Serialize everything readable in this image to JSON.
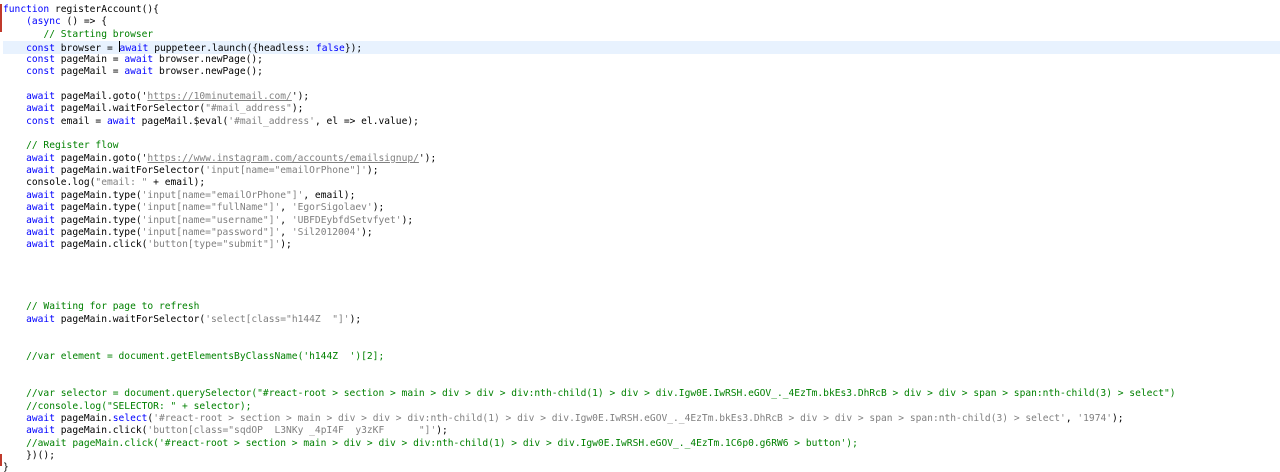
{
  "colors": {
    "background": "#ffffff",
    "keyword": "#0000ff",
    "comment": "#008000",
    "string": "#808080",
    "text": "#000000",
    "active_line": "#e8f2fe",
    "gutter_marker": "#c0392b"
  },
  "active_line_index": 3,
  "lines": [
    [
      {
        "t": "kw",
        "v": "function"
      },
      {
        "t": "txt",
        "v": " registerAccount(){"
      }
    ],
    [
      {
        "t": "txt",
        "v": "    "
      },
      {
        "t": "kw",
        "v": "(async"
      },
      {
        "t": "txt",
        "v": " () => {"
      }
    ],
    [
      {
        "t": "txt",
        "v": "       "
      },
      {
        "t": "cm",
        "v": "// Starting browser"
      }
    ],
    [
      {
        "t": "txt",
        "v": "    "
      },
      {
        "t": "kw",
        "v": "const"
      },
      {
        "t": "txt",
        "v": " browser = "
      },
      {
        "t": "kw",
        "v": "await"
      },
      {
        "t": "txt",
        "v": " puppeteer.launch({headless: "
      },
      {
        "t": "kw",
        "v": "false"
      },
      {
        "t": "txt",
        "v": "});"
      }
    ],
    [
      {
        "t": "txt",
        "v": "    "
      },
      {
        "t": "kw",
        "v": "const"
      },
      {
        "t": "txt",
        "v": " pageMain = "
      },
      {
        "t": "kw",
        "v": "await"
      },
      {
        "t": "txt",
        "v": " browser.newPage();"
      }
    ],
    [
      {
        "t": "txt",
        "v": "    "
      },
      {
        "t": "kw",
        "v": "const"
      },
      {
        "t": "txt",
        "v": " pageMail = "
      },
      {
        "t": "kw",
        "v": "await"
      },
      {
        "t": "txt",
        "v": " browser.newPage();"
      }
    ],
    [
      {
        "t": "txt",
        "v": ""
      }
    ],
    [
      {
        "t": "txt",
        "v": "    "
      },
      {
        "t": "kw",
        "v": "await"
      },
      {
        "t": "txt",
        "v": " pageMail.goto('"
      },
      {
        "t": "url",
        "v": "https://10minutemail.com/"
      },
      {
        "t": "txt",
        "v": "');"
      }
    ],
    [
      {
        "t": "txt",
        "v": "    "
      },
      {
        "t": "kw",
        "v": "await"
      },
      {
        "t": "txt",
        "v": " pageMail.waitForSelector("
      },
      {
        "t": "str",
        "v": "\"#mail_address\""
      },
      {
        "t": "txt",
        "v": ");"
      }
    ],
    [
      {
        "t": "txt",
        "v": "    "
      },
      {
        "t": "kw",
        "v": "const"
      },
      {
        "t": "txt",
        "v": " email = "
      },
      {
        "t": "kw",
        "v": "await"
      },
      {
        "t": "txt",
        "v": " pageMail.$eval("
      },
      {
        "t": "str",
        "v": "'#mail_address'"
      },
      {
        "t": "txt",
        "v": ", el => el.value);"
      }
    ],
    [
      {
        "t": "txt",
        "v": ""
      }
    ],
    [
      {
        "t": "txt",
        "v": "    "
      },
      {
        "t": "cm",
        "v": "// Register flow"
      }
    ],
    [
      {
        "t": "txt",
        "v": "    "
      },
      {
        "t": "kw",
        "v": "await"
      },
      {
        "t": "txt",
        "v": " pageMain.goto('"
      },
      {
        "t": "url",
        "v": "https://www.instagram.com/accounts/emailsignup/"
      },
      {
        "t": "txt",
        "v": "');"
      }
    ],
    [
      {
        "t": "txt",
        "v": "    "
      },
      {
        "t": "kw",
        "v": "await"
      },
      {
        "t": "txt",
        "v": " pageMain.waitForSelector("
      },
      {
        "t": "str",
        "v": "'input[name=\"emailOrPhone\"]'"
      },
      {
        "t": "txt",
        "v": ");"
      }
    ],
    [
      {
        "t": "txt",
        "v": "    console.log("
      },
      {
        "t": "str",
        "v": "\"email: \""
      },
      {
        "t": "txt",
        "v": " + email);"
      }
    ],
    [
      {
        "t": "txt",
        "v": "    "
      },
      {
        "t": "kw",
        "v": "await"
      },
      {
        "t": "txt",
        "v": " pageMain.type("
      },
      {
        "t": "str",
        "v": "'input[name=\"emailOrPhone\"]'"
      },
      {
        "t": "txt",
        "v": ", email);"
      }
    ],
    [
      {
        "t": "txt",
        "v": "    "
      },
      {
        "t": "kw",
        "v": "await"
      },
      {
        "t": "txt",
        "v": " pageMain.type("
      },
      {
        "t": "str",
        "v": "'input[name=\"fullName\"]'"
      },
      {
        "t": "txt",
        "v": ", "
      },
      {
        "t": "str",
        "v": "'EgorSigolaev'"
      },
      {
        "t": "txt",
        "v": ");"
      }
    ],
    [
      {
        "t": "txt",
        "v": "    "
      },
      {
        "t": "kw",
        "v": "await"
      },
      {
        "t": "txt",
        "v": " pageMain.type("
      },
      {
        "t": "str",
        "v": "'input[name=\"username\"]'"
      },
      {
        "t": "txt",
        "v": ", "
      },
      {
        "t": "str",
        "v": "'UBFDEybfdSetvfyet'"
      },
      {
        "t": "txt",
        "v": ");"
      }
    ],
    [
      {
        "t": "txt",
        "v": "    "
      },
      {
        "t": "kw",
        "v": "await"
      },
      {
        "t": "txt",
        "v": " pageMain.type("
      },
      {
        "t": "str",
        "v": "'input[name=\"password\"]'"
      },
      {
        "t": "txt",
        "v": ", "
      },
      {
        "t": "str",
        "v": "'Sil2012004'"
      },
      {
        "t": "txt",
        "v": ");"
      }
    ],
    [
      {
        "t": "txt",
        "v": "    "
      },
      {
        "t": "kw",
        "v": "await"
      },
      {
        "t": "txt",
        "v": " pageMain.click("
      },
      {
        "t": "str",
        "v": "'button[type=\"submit\"]'"
      },
      {
        "t": "txt",
        "v": ");"
      }
    ],
    [
      {
        "t": "txt",
        "v": ""
      }
    ],
    [
      {
        "t": "txt",
        "v": ""
      }
    ],
    [
      {
        "t": "txt",
        "v": ""
      }
    ],
    [
      {
        "t": "txt",
        "v": ""
      }
    ],
    [
      {
        "t": "txt",
        "v": "    "
      },
      {
        "t": "cm",
        "v": "// Waiting for page to refresh"
      }
    ],
    [
      {
        "t": "txt",
        "v": "    "
      },
      {
        "t": "kw",
        "v": "await"
      },
      {
        "t": "txt",
        "v": " pageMain.waitForSelector("
      },
      {
        "t": "str",
        "v": "'select[class=\"h144Z  \"]'"
      },
      {
        "t": "txt",
        "v": ");"
      }
    ],
    [
      {
        "t": "txt",
        "v": ""
      }
    ],
    [
      {
        "t": "txt",
        "v": ""
      }
    ],
    [
      {
        "t": "txt",
        "v": "    "
      },
      {
        "t": "cm",
        "v": "//var element = document.getElementsByClassName('h144Z  ')[2];"
      }
    ],
    [
      {
        "t": "txt",
        "v": ""
      }
    ],
    [
      {
        "t": "txt",
        "v": ""
      }
    ],
    [
      {
        "t": "txt",
        "v": "    "
      },
      {
        "t": "cm",
        "v": "//var selector = document.querySelector(\"#react-root > section > main > div > div > div:nth-child(1) > div > div.Igw0E.IwRSH.eGOV_._4EzTm.bkEs3.DhRcB > div > div > span > span:nth-child(3) > select\")"
      }
    ],
    [
      {
        "t": "txt",
        "v": "    "
      },
      {
        "t": "cm",
        "v": "//console.log(\"SELECTOR: \" + selector);"
      }
    ],
    [
      {
        "t": "txt",
        "v": "    "
      },
      {
        "t": "kw",
        "v": "await"
      },
      {
        "t": "txt",
        "v": " pageMain."
      },
      {
        "t": "kw",
        "v": "select"
      },
      {
        "t": "txt",
        "v": "("
      },
      {
        "t": "str",
        "v": "'#react-root > section > main > div > div > div:nth-child(1) > div > div.Igw0E.IwRSH.eGOV_._4EzTm.bkEs3.DhRcB > div > div > span > span:nth-child(3) > select'"
      },
      {
        "t": "txt",
        "v": ", "
      },
      {
        "t": "str",
        "v": "'1974'"
      },
      {
        "t": "txt",
        "v": ");"
      }
    ],
    [
      {
        "t": "txt",
        "v": "    "
      },
      {
        "t": "kw",
        "v": "await"
      },
      {
        "t": "txt",
        "v": " pageMain.click("
      },
      {
        "t": "str",
        "v": "'button[class=\"sqdOP  L3NKy _4pI4F  y3zKF      \"]'"
      },
      {
        "t": "txt",
        "v": ");"
      }
    ],
    [
      {
        "t": "txt",
        "v": "    "
      },
      {
        "t": "cm",
        "v": "//await pageMain.click('#react-root > section > main > div > div > div:nth-child(1) > div > div.Igw0E.IwRSH.eGOV_._4EzTm.1C6p0.g6RW6 > button');"
      }
    ],
    [
      {
        "t": "txt",
        "v": "    })();"
      }
    ],
    [
      {
        "t": "txt",
        "v": "}"
      }
    ]
  ]
}
